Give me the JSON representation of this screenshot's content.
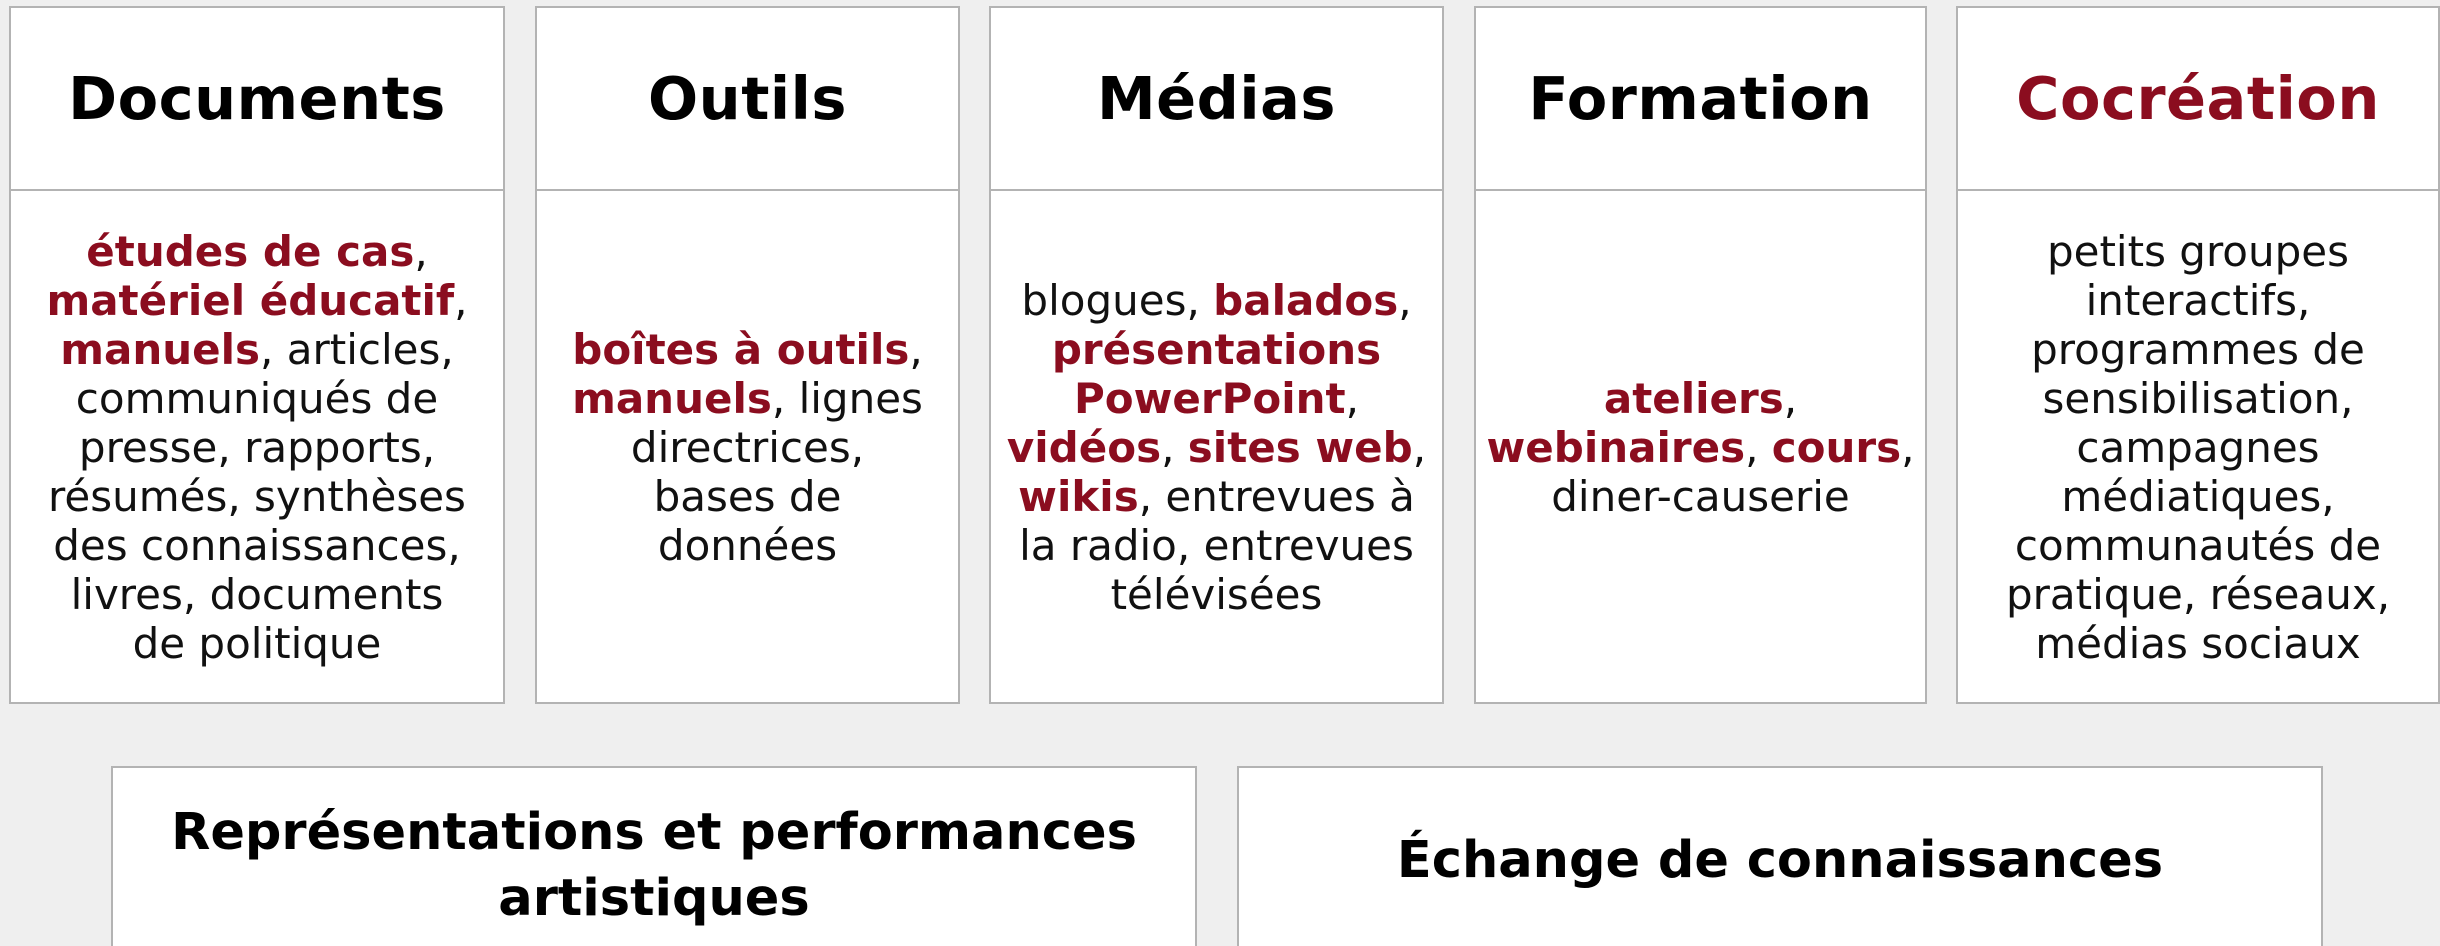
{
  "colors": {
    "accent": "#8b0d1f",
    "border": "#b3b3b3",
    "background": "#efefef",
    "card": "#ffffff"
  },
  "cards": [
    {
      "title": "Documents",
      "content": [
        {
          "t": "études de cas",
          "h": true
        },
        {
          "t": ",\n"
        },
        {
          "t": "matériel éducatif",
          "h": true
        },
        {
          "t": ",\n"
        },
        {
          "t": "manuels",
          "h": true
        },
        {
          "t": ", articles,\ncommuniqués de\npresse, rapports,\nrésumés, synthèses\ndes connaissances,\nlivres, documents\nde politique"
        }
      ]
    },
    {
      "title": "Outils",
      "content": [
        {
          "t": "boîtes à outils",
          "h": true
        },
        {
          "t": ",\n"
        },
        {
          "t": "manuels",
          "h": true
        },
        {
          "t": ", lignes\ndirectrices,\nbases de\ndonnées"
        }
      ]
    },
    {
      "title": "Médias",
      "content": [
        {
          "t": "blogues, "
        },
        {
          "t": "balados",
          "h": true
        },
        {
          "t": ",\n"
        },
        {
          "t": "présentations\nPowerPoint",
          "h": true
        },
        {
          "t": ",\n"
        },
        {
          "t": "vidéos",
          "h": true
        },
        {
          "t": ", "
        },
        {
          "t": "sites web",
          "h": true
        },
        {
          "t": ",\n"
        },
        {
          "t": "wikis",
          "h": true
        },
        {
          "t": ", entrevues à\nla radio, entrevues\ntélévisées"
        }
      ]
    },
    {
      "title": "Formation",
      "content": [
        {
          "t": "ateliers",
          "h": true
        },
        {
          "t": ",\n"
        },
        {
          "t": "webinaires",
          "h": true
        },
        {
          "t": ", "
        },
        {
          "t": "cours",
          "h": true
        },
        {
          "t": ",\ndiner-causerie"
        }
      ]
    },
    {
      "title": "Cocréation",
      "title_accent": true,
      "content": [
        {
          "t": "petits groupes\ninteractifs,\nprogrammes de\nsensibilisation,\ncampagnes\nmédiatiques,\ncommunautés de\npratique, réseaux,\nmédias sociaux"
        }
      ]
    }
  ],
  "bottom": {
    "representations_title": "Représentations et performances\nartistiques",
    "echange_title": "Échange de connaissances"
  }
}
